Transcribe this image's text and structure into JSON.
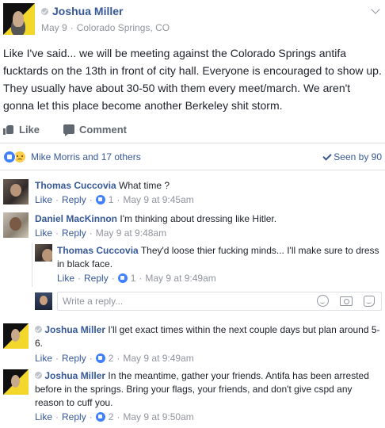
{
  "post": {
    "author": "Joshua Miller",
    "date": "May 9",
    "separator": "·",
    "location": "Colorado Springs, CO",
    "text": "Like I've said... we will be meeting against the Colorado Springs antifa fucktards on the 13th in front of city hall. Everyone is encouraged to show up. They usually have about 30-50 with them every meet/march. We aren't gonna let this place become another Berkeley shit storm.",
    "actions": {
      "like": "Like",
      "comment": "Comment"
    },
    "reactions_text": "Mike Morris and 17 others",
    "seen_text": "Seen by 90"
  },
  "comments": [
    {
      "author": "Thomas Cuccovia",
      "text": "What time ?",
      "like": "Like",
      "reply": "Reply",
      "dot": "·",
      "likes": "1",
      "time": "May 9 at 9:45am"
    },
    {
      "author": "Daniel MacKinnon",
      "text": "I'm thinking about dressing like Hitler.",
      "like": "Like",
      "reply": "Reply",
      "dot": "·",
      "time": "May 9 at 9:48am"
    },
    {
      "author": "Thomas Cuccovia",
      "text": "They'd loose thier fucking minds... I'll make sure to dress in black face.",
      "like": "Like",
      "reply": "Reply",
      "dot": "·",
      "likes": "1",
      "time": "May 9 at 9:49am"
    },
    {
      "author": "Joshua Miller",
      "text": "I'll get exact times within the next couple days but plan around 5-6.",
      "like": "Like",
      "reply": "Reply",
      "dot": "·",
      "likes": "2",
      "time": "May 9 at 9:49am"
    },
    {
      "author": "Joshua Miller",
      "text": "In the meantime, gather your friends. Antifa has been arrested before in the springs. Bring your flags, your friends, and don't give cspd any reason to cuff you.",
      "like": "Like",
      "reply": "Reply",
      "dot": "·",
      "likes": "2",
      "time": "May 9 at 9:50am"
    }
  ],
  "reply_box": {
    "placeholder": "Write a reply..."
  },
  "colors": {
    "link": "#365899",
    "meta": "#90949c",
    "like_blue": "#4080ff",
    "divider": "#dddfe2"
  },
  "icons": [
    "verified-icon",
    "chevron-down-icon",
    "like-icon",
    "comment-icon",
    "like-reaction-icon",
    "sad-reaction-icon",
    "check-icon",
    "emoji-icon",
    "camera-icon",
    "sticker-icon"
  ]
}
